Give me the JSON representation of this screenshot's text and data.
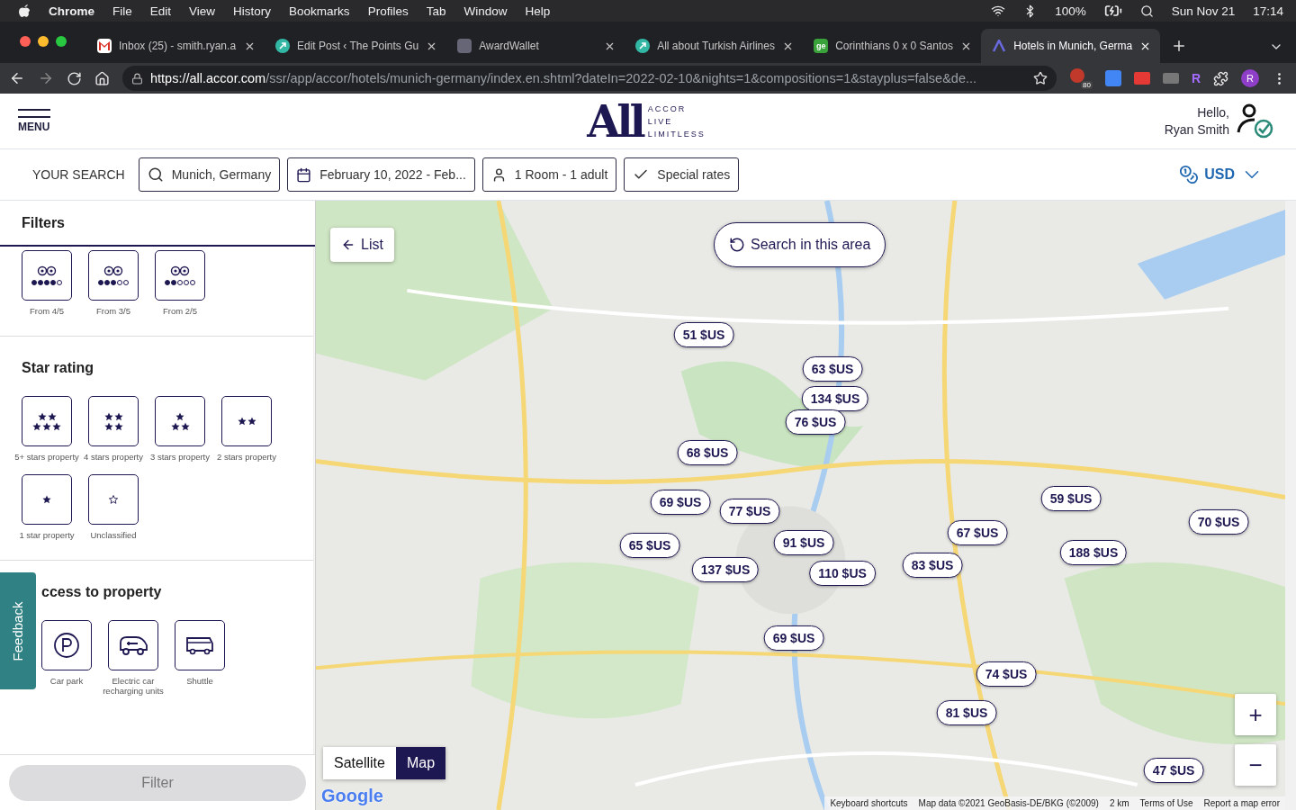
{
  "menu_bar": {
    "app": "Chrome",
    "items": [
      "File",
      "Edit",
      "View",
      "History",
      "Bookmarks",
      "Profiles",
      "Tab",
      "Window",
      "Help"
    ],
    "battery": "100%",
    "date": "Sun Nov 21",
    "time": "17:14"
  },
  "browser_tabs": [
    {
      "title": "Inbox (25) - smith.ryan.a",
      "kind": "mail",
      "selected": false
    },
    {
      "title": "Edit Post ‹ The Points Gu",
      "kind": "arrow",
      "selected": false
    },
    {
      "title": "AwardWallet",
      "kind": "wallet",
      "selected": false
    },
    {
      "title": "All about Turkish Airlines",
      "kind": "arrow",
      "selected": false
    },
    {
      "title": "Corinthians 0 x 0 Santos",
      "kind": "ge",
      "selected": false
    },
    {
      "title": "Hotels in Munich, Germa",
      "kind": "accor",
      "selected": true
    }
  ],
  "ge_badge": "ge",
  "address_bar": {
    "host": "https://all.accor.com",
    "path": "/ssr/app/accor/hotels/munich-germany/index.en.shtml?dateIn=2022-02-10&nights=1&compositions=1&stayplus=false&de..."
  },
  "extension_badge": "80",
  "profile_initial": "R",
  "extension_letter": "R",
  "header": {
    "menu_label": "MENU",
    "logo_mark": "All",
    "logo_words": [
      "ACCOR",
      "LIVE",
      "LIMITLESS"
    ],
    "greeting": "Hello,",
    "user_name": "Ryan Smith"
  },
  "search_bar": {
    "label": "YOUR SEARCH",
    "destination": "Munich, Germany",
    "dates": "February 10, 2022 - Feb...",
    "guests": "1 Room - 1 adult",
    "rates": "Special rates",
    "currency": "USD"
  },
  "filters": {
    "title": "Filters",
    "review_options": [
      {
        "label": "From 4/5",
        "stars": 4
      },
      {
        "label": "From 3/5",
        "stars": 3
      },
      {
        "label": "From 2/5",
        "stars": 2
      }
    ],
    "star_title": "Star rating",
    "star_options": [
      {
        "label": "5+ stars property",
        "kind": "five"
      },
      {
        "label": "4 stars property",
        "kind": "four"
      },
      {
        "label": "3 stars property",
        "kind": "three"
      },
      {
        "label": "2 stars property",
        "kind": "two"
      },
      {
        "label": "1 star property",
        "kind": "one"
      },
      {
        "label": "Unclassified",
        "kind": "unclassified"
      }
    ],
    "access_title": "ccess to property",
    "access_options": [
      {
        "label": "Car park",
        "kind": "parking"
      },
      {
        "label": "Electric car recharging units",
        "kind": "ev"
      },
      {
        "label": "Shuttle",
        "kind": "shuttle"
      }
    ],
    "filter_button": "Filter",
    "filter_disabled": true
  },
  "feedback": "Feedback",
  "map": {
    "list_button": "List",
    "search_area": "Search in this area",
    "pins": [
      "51 $US",
      "63 $US",
      "134 $US",
      "76 $US",
      "68 $US",
      "69 $US",
      "77 $US",
      "137 $US",
      "91 $US",
      "65 $US",
      "110 $US",
      "83 $US",
      "67 $US",
      "59 $US",
      "70 $US",
      "188 $US",
      "69 $US",
      "74 $US",
      "81 $US",
      "47 $US"
    ],
    "map_types": [
      {
        "label": "Satellite",
        "selected": false
      },
      {
        "label": "Map",
        "selected": true
      }
    ],
    "zoom_in": "+",
    "zoom_out": "−",
    "logo": "Google",
    "attribution": [
      "Keyboard shortcuts",
      "Map data ©2021 GeoBasis-DE/BKG (©2009)",
      "2 km",
      "Terms of Use",
      "Report a map error"
    ]
  }
}
